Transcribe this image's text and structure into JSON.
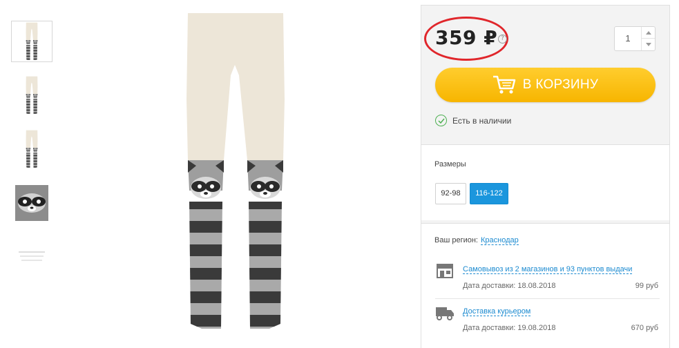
{
  "thumbnails": [
    {
      "name": "thumb-front"
    },
    {
      "name": "thumb-side"
    },
    {
      "name": "thumb-back"
    },
    {
      "name": "thumb-detail"
    },
    {
      "name": "thumb-label"
    }
  ],
  "product": {
    "price": "359 ₽",
    "help_icon": "?",
    "quantity": "1",
    "cart_button": "В КОРЗИНУ",
    "stock": "Есть в наличии"
  },
  "sizes": {
    "title": "Размеры",
    "options": [
      "92-98",
      "116-122"
    ],
    "selected": "116-122"
  },
  "delivery": {
    "region_label": "Ваш регион:",
    "region": "Краснодар",
    "options": [
      {
        "icon": "store-icon",
        "title": "Самовывоз из 2 магазинов и 93 пунктов выдачи",
        "date": "Дата доставки: 18.08.2018",
        "price": "99 руб"
      },
      {
        "icon": "truck-icon",
        "title": "Доставка курьером",
        "date": "Дата доставки: 19.08.2018",
        "price": "670 руб"
      }
    ]
  },
  "colors": {
    "accent_yellow": "#f7b500",
    "selected_blue": "#1b96dd",
    "link_blue": "#1b8ad0",
    "price_circle": "#e0262b",
    "stock_green": "#4caf50"
  }
}
